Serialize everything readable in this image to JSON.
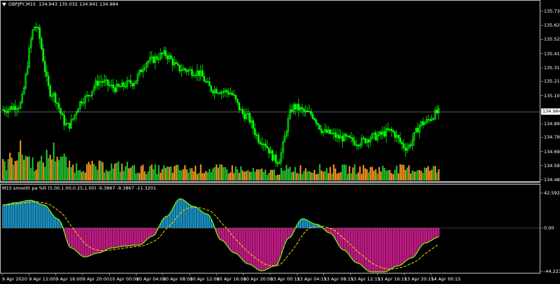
{
  "main_panel": {
    "header": {
      "symbol": "GBPJPY,M15",
      "ohlc": "134.943 135.032 134.941 134.984"
    },
    "current_price": "134.984",
    "y_ticks": [
      "135.730",
      "135.625",
      "135.520",
      "135.415",
      "135.310",
      "135.210",
      "135.105",
      "134.895",
      "134.795",
      "134.690",
      "134.585",
      "134.480"
    ]
  },
  "indicator_panel": {
    "header": "M15  smooth pa %R (5.00,1.00,0.25,1.00) -9.3867 -9.3867 -11.3201",
    "y_ticks": [
      "42.592",
      "0.00",
      "-44.223"
    ]
  },
  "x_ticks": [
    "9 Apr 2020",
    "9 Apr 12:00",
    "9 Apr 16:00",
    "9 Apr 20:00",
    "10 Apr 00:00",
    "10 Apr 04:00",
    "10 Apr 08:00",
    "10 Apr 12:00",
    "10 Apr 16:00",
    "10 Apr 20:00",
    "13 Apr 00:15",
    "13 Apr 04:15",
    "13 Apr 08:15",
    "13 Apr 12:15",
    "13 Apr 16:15",
    "13 Apr 20:15",
    "14 Apr 00:15"
  ],
  "colors": {
    "bull_candle": "#00ff00",
    "volume_up": "#22c832",
    "volume_down": "#ff9a20",
    "osc_positive": "#1ea7e1",
    "osc_negative": "#e0209a",
    "osc_line": "#7cfc00",
    "signal_line": "#ffd700",
    "gridline": "#c0c0c0"
  },
  "chart_data": {
    "type": "line",
    "title": "",
    "price_key_points": [
      135.0,
      135.03,
      135.62,
      135.12,
      134.88,
      135.08,
      135.21,
      135.16,
      135.2,
      135.36,
      135.41,
      135.3,
      135.28,
      135.15,
      135.13,
      134.96,
      134.77,
      134.62,
      135.02,
      134.97,
      134.83,
      134.79,
      134.76,
      134.8,
      134.84,
      134.72,
      134.9,
      134.98
    ],
    "osc_key_points": [
      30,
      33,
      36,
      30,
      12,
      -20,
      -29,
      -25,
      -20,
      -18,
      -17,
      -8,
      15,
      38,
      28,
      18,
      -12,
      -25,
      -36,
      -43,
      -38,
      -10,
      12,
      5,
      -5,
      -22,
      -35,
      -44,
      -44,
      -38,
      -30,
      -15,
      -9
    ]
  }
}
